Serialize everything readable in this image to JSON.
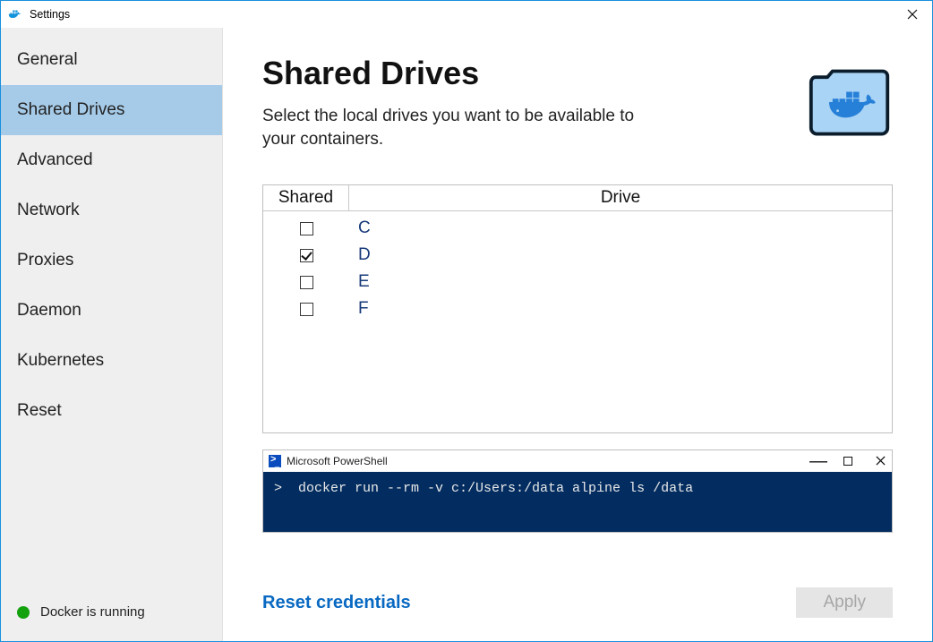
{
  "window": {
    "title": "Settings"
  },
  "sidebar": {
    "items": [
      {
        "label": "General",
        "active": false
      },
      {
        "label": "Shared Drives",
        "active": true
      },
      {
        "label": "Advanced",
        "active": false
      },
      {
        "label": "Network",
        "active": false
      },
      {
        "label": "Proxies",
        "active": false
      },
      {
        "label": "Daemon",
        "active": false
      },
      {
        "label": "Kubernetes",
        "active": false
      },
      {
        "label": "Reset",
        "active": false
      }
    ]
  },
  "status": {
    "text": "Docker is running",
    "color": "#13a10e"
  },
  "main": {
    "title": "Shared Drives",
    "subtitle": "Select the local drives you want to be available to your containers.",
    "table": {
      "columns": {
        "shared": "Shared",
        "drive": "Drive"
      },
      "rows": [
        {
          "drive": "C",
          "checked": false
        },
        {
          "drive": "D",
          "checked": true
        },
        {
          "drive": "E",
          "checked": false
        },
        {
          "drive": "F",
          "checked": false
        }
      ]
    },
    "powershell": {
      "title": "Microsoft PowerShell",
      "command": ">  docker run --rm -v c:/Users:/data alpine ls /data"
    },
    "reset_link": "Reset credentials",
    "apply_label": "Apply"
  }
}
